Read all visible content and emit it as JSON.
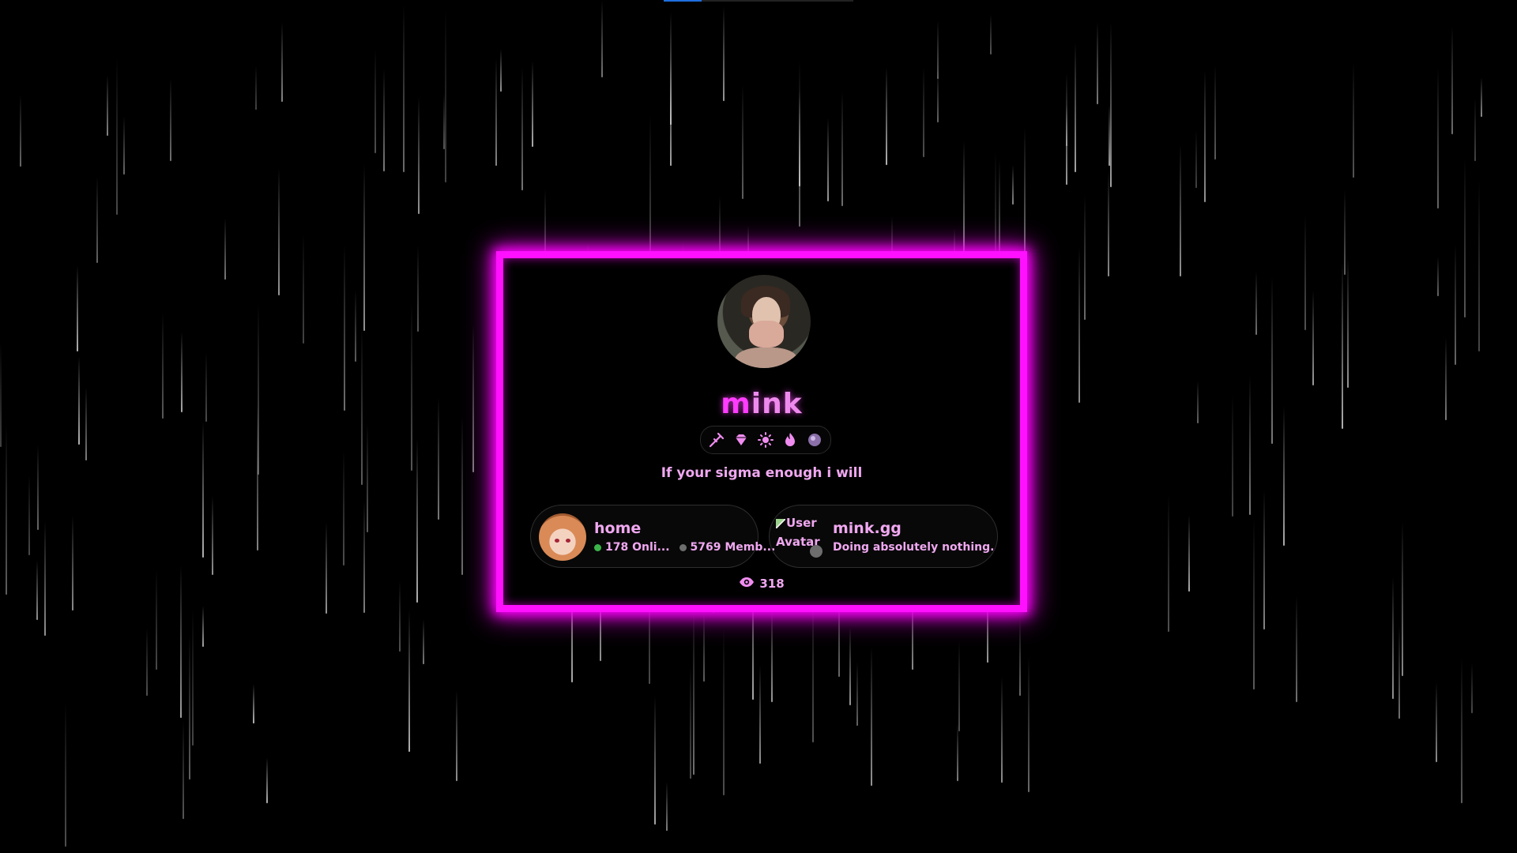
{
  "profile": {
    "name_first": "m",
    "name_rest": "ink",
    "bio": "If your sigma enough i will",
    "accent_color": "#ff10ff"
  },
  "badges": [
    {
      "icon": "syringe-icon"
    },
    {
      "icon": "diamond-icon"
    },
    {
      "icon": "sun-icon"
    },
    {
      "icon": "flame-icon"
    },
    {
      "icon": "orb-icon"
    }
  ],
  "server_widget": {
    "title": "home",
    "online": "178 Onli...",
    "members": "5769 Memb..."
  },
  "presence_widget": {
    "avatar_alt": "User Avatar",
    "title": "mink.gg",
    "status": "Doing absolutely nothing."
  },
  "views": {
    "count": "318"
  }
}
